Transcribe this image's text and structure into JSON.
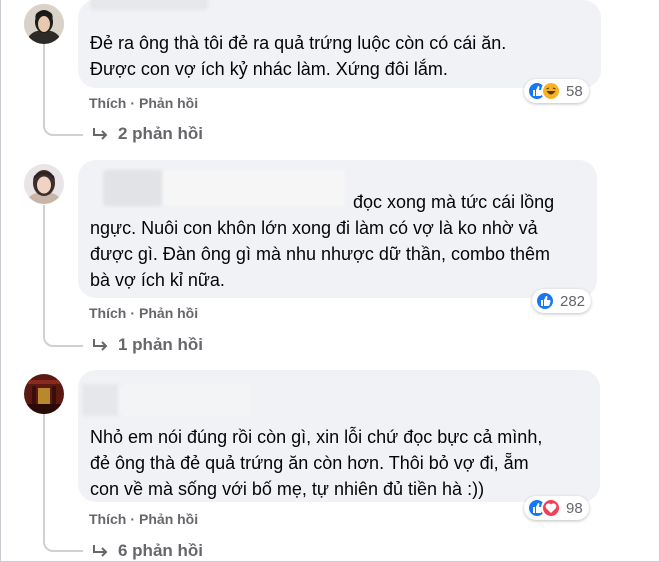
{
  "colors": {
    "bubble": "#f0f2f5",
    "secondary_text": "#65676b",
    "like_blue": "#1877f2",
    "haha_yellow": "#f7b125",
    "love_red": "#f33e58"
  },
  "comments": [
    {
      "author_partial": "Nguyễn Nhâ",
      "lines": [
        "Đẻ ra ông thà tôi đẻ ra quả trứng luộc còn có cái ăn.",
        "Được con vợ ích kỷ nhác làm. Xứng đôi lắm."
      ],
      "actions": {
        "like": "Thích",
        "reply": "Phản hồi"
      },
      "reactions": {
        "icons": [
          "like-icon",
          "haha-icon"
        ],
        "count": "58"
      },
      "replies_label": "2 phản hồi"
    },
    {
      "lines": [
        "đọc xong mà tức cái lồng",
        "ngực. Nuôi con khôn lớn xong đi làm có vợ là ko nhờ vả",
        "được gì. Đàn ông gì mà nhu nhược dữ thần, combo thêm",
        "bà vợ ích kỉ nữa."
      ],
      "actions": {
        "like": "Thích",
        "reply": "Phản hồi"
      },
      "reactions": {
        "icons": [
          "like-icon"
        ],
        "count": "282"
      },
      "replies_label": "1 phản hồi"
    },
    {
      "lines": [
        "Nhỏ em nói đúng rồi còn gì, xin lỗi chứ đọc bực cả mình,",
        "đẻ ông thà đẻ quả trứng ăn còn hơn. Thôi bỏ vợ đi, ẵm",
        "con về mà sống với bố mẹ, tự nhiên đủ tiền hà :))"
      ],
      "actions": {
        "like": "Thích",
        "reply": "Phản hồi"
      },
      "reactions": {
        "icons": [
          "like-icon",
          "love-icon"
        ],
        "count": "98"
      },
      "replies_label": "6 phản hồi"
    }
  ]
}
